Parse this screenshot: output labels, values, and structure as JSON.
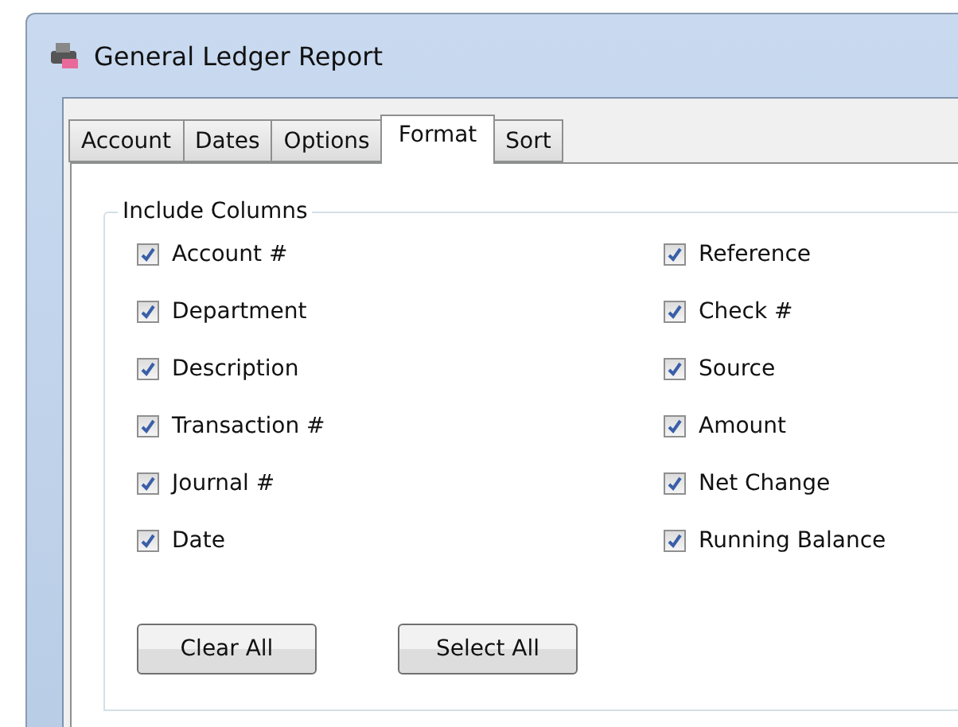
{
  "window": {
    "title": "General Ledger Report"
  },
  "tabs": [
    {
      "label": "Account",
      "selected": false
    },
    {
      "label": "Dates",
      "selected": false
    },
    {
      "label": "Options",
      "selected": false
    },
    {
      "label": "Format",
      "selected": true
    },
    {
      "label": "Sort",
      "selected": false
    }
  ],
  "include_columns": {
    "title": "Include Columns",
    "columns": [
      [
        {
          "label": "Account #",
          "checked": true
        },
        {
          "label": "Department",
          "checked": true
        },
        {
          "label": "Description",
          "checked": true
        },
        {
          "label": "Transaction #",
          "checked": true
        },
        {
          "label": "Journal #",
          "checked": true
        },
        {
          "label": "Date",
          "checked": true
        }
      ],
      [
        {
          "label": "Reference",
          "checked": true
        },
        {
          "label": "Check #",
          "checked": true
        },
        {
          "label": "Source",
          "checked": true
        },
        {
          "label": "Amount",
          "checked": true
        },
        {
          "label": "Net Change",
          "checked": true
        },
        {
          "label": "Running Balance",
          "checked": true
        }
      ]
    ]
  },
  "buttons": [
    "Clear All",
    "Select All"
  ]
}
